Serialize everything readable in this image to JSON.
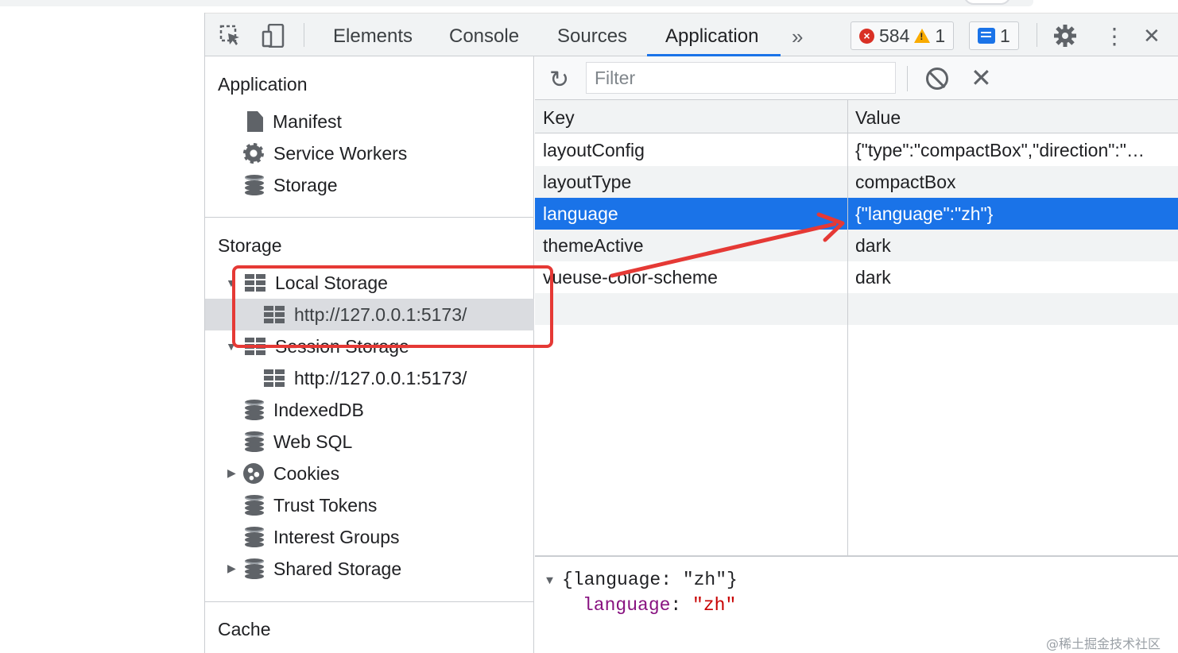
{
  "tabbar": {
    "tabs": [
      {
        "label": "Elements"
      },
      {
        "label": "Console"
      },
      {
        "label": "Sources"
      },
      {
        "label": "Application",
        "active": true
      }
    ],
    "errors": "584",
    "warnings": "1",
    "messages": "1",
    "more_tabs_glyph": "»",
    "close_glyph": "✕",
    "kebab_glyph": "⋮"
  },
  "sidebar": {
    "application_header": "Application",
    "application_items": [
      "Manifest",
      "Service Workers",
      "Storage"
    ],
    "storage_header": "Storage",
    "storage_items": [
      {
        "label": "Local Storage",
        "expanded": true
      },
      {
        "label": "http://127.0.0.1:5173/",
        "selected": true
      },
      {
        "label": "Session Storage",
        "expanded": true
      },
      {
        "label": "http://127.0.0.1:5173/"
      },
      {
        "label": "IndexedDB"
      },
      {
        "label": "Web SQL"
      },
      {
        "label": "Cookies",
        "collapsed": true
      },
      {
        "label": "Trust Tokens"
      },
      {
        "label": "Interest Groups"
      },
      {
        "label": "Shared Storage",
        "collapsed": true
      }
    ],
    "cache_header": "Cache"
  },
  "toolbar": {
    "filter_placeholder": "Filter",
    "refresh_glyph": "↻",
    "clear_glyph": "✕"
  },
  "table": {
    "headers": [
      "Key",
      "Value"
    ],
    "rows": [
      {
        "key": "layoutConfig",
        "value": "{\"type\":\"compactBox\",\"direction\":\"LR\"}"
      },
      {
        "key": "layoutType",
        "value": "compactBox"
      },
      {
        "key": "language",
        "value": "{\"language\":\"zh\"}",
        "selected": true
      },
      {
        "key": "themeActive",
        "value": "dark"
      },
      {
        "key": "vueuse-color-scheme",
        "value": "dark"
      }
    ]
  },
  "preview": {
    "summary": "{language: \"zh\"}",
    "prop_key": "language",
    "prop_sep": ": ",
    "prop_value": "\"zh\""
  },
  "watermark": "@稀土掘金技术社区",
  "colors": {
    "accent": "#1a73e8",
    "annotation": "#e53935",
    "error": "#d93025",
    "warning": "#f9ab00"
  }
}
